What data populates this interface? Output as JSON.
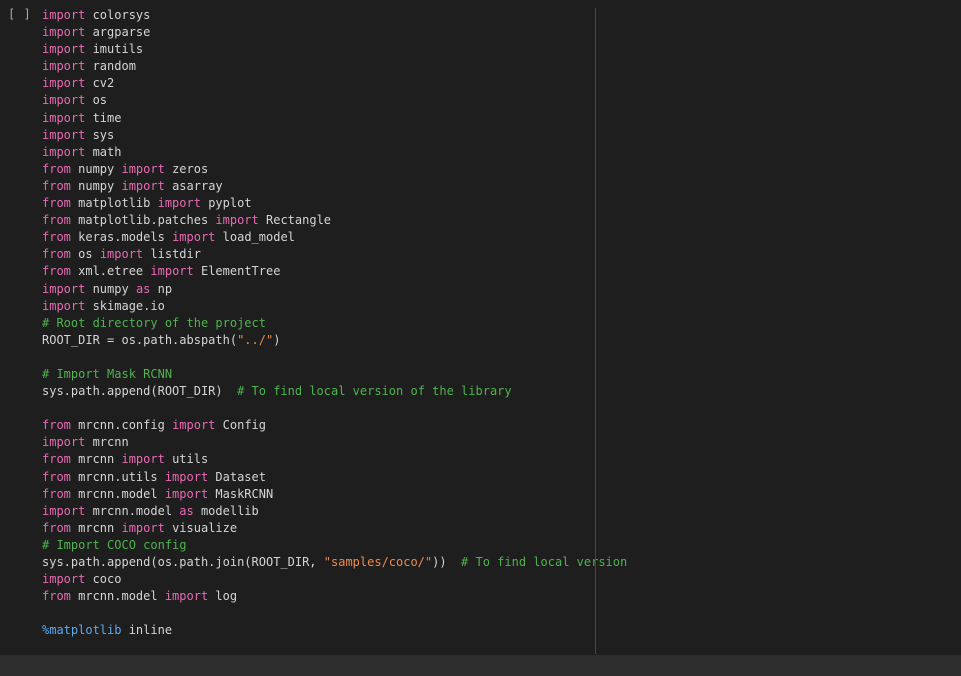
{
  "cell": {
    "run_indicator": "[ ]",
    "lines": [
      [
        {
          "t": "import",
          "c": "kw"
        },
        {
          "t": " colorsys",
          "c": "tx"
        }
      ],
      [
        {
          "t": "import",
          "c": "kw"
        },
        {
          "t": " argparse",
          "c": "tx"
        }
      ],
      [
        {
          "t": "import",
          "c": "kw"
        },
        {
          "t": " imutils",
          "c": "tx"
        }
      ],
      [
        {
          "t": "import",
          "c": "kw"
        },
        {
          "t": " random",
          "c": "tx"
        }
      ],
      [
        {
          "t": "import",
          "c": "kw"
        },
        {
          "t": " cv2",
          "c": "tx"
        }
      ],
      [
        {
          "t": "import",
          "c": "kw"
        },
        {
          "t": " os",
          "c": "tx"
        }
      ],
      [
        {
          "t": "import",
          "c": "kw"
        },
        {
          "t": " time",
          "c": "tx"
        }
      ],
      [
        {
          "t": "import",
          "c": "kw"
        },
        {
          "t": " sys",
          "c": "tx"
        }
      ],
      [
        {
          "t": "import",
          "c": "kw"
        },
        {
          "t": " math",
          "c": "tx"
        }
      ],
      [
        {
          "t": "from",
          "c": "kw"
        },
        {
          "t": " numpy ",
          "c": "tx"
        },
        {
          "t": "import",
          "c": "kw"
        },
        {
          "t": " zeros",
          "c": "tx"
        }
      ],
      [
        {
          "t": "from",
          "c": "kw"
        },
        {
          "t": " numpy ",
          "c": "tx"
        },
        {
          "t": "import",
          "c": "kw"
        },
        {
          "t": " asarray",
          "c": "tx"
        }
      ],
      [
        {
          "t": "from",
          "c": "kw"
        },
        {
          "t": " matplotlib ",
          "c": "tx"
        },
        {
          "t": "import",
          "c": "kw"
        },
        {
          "t": " pyplot",
          "c": "tx"
        }
      ],
      [
        {
          "t": "from",
          "c": "kw"
        },
        {
          "t": " matplotlib.patches ",
          "c": "tx"
        },
        {
          "t": "import",
          "c": "kw"
        },
        {
          "t": " Rectangle",
          "c": "tx"
        }
      ],
      [
        {
          "t": "from",
          "c": "kw"
        },
        {
          "t": " keras.models ",
          "c": "tx"
        },
        {
          "t": "import",
          "c": "kw"
        },
        {
          "t": " load_model",
          "c": "tx"
        }
      ],
      [
        {
          "t": "from",
          "c": "kw"
        },
        {
          "t": " os ",
          "c": "tx"
        },
        {
          "t": "import",
          "c": "kw"
        },
        {
          "t": " listdir",
          "c": "tx"
        }
      ],
      [
        {
          "t": "from",
          "c": "kw"
        },
        {
          "t": " xml.etree ",
          "c": "tx"
        },
        {
          "t": "import",
          "c": "kw"
        },
        {
          "t": " ElementTree",
          "c": "tx"
        }
      ],
      [
        {
          "t": "import",
          "c": "kw"
        },
        {
          "t": " numpy ",
          "c": "tx"
        },
        {
          "t": "as",
          "c": "kw"
        },
        {
          "t": " np",
          "c": "tx"
        }
      ],
      [
        {
          "t": "import",
          "c": "kw"
        },
        {
          "t": " skimage.io",
          "c": "tx"
        }
      ],
      [
        {
          "t": "# Root directory of the project",
          "c": "cm"
        }
      ],
      [
        {
          "t": "ROOT_DIR = os.path.abspath(",
          "c": "tx"
        },
        {
          "t": "\"../\"",
          "c": "st"
        },
        {
          "t": ")",
          "c": "tx"
        }
      ],
      [],
      [
        {
          "t": "# Import Mask RCNN",
          "c": "cm"
        }
      ],
      [
        {
          "t": "sys.path.append(ROOT_DIR)  ",
          "c": "tx"
        },
        {
          "t": "# To find local version of the library",
          "c": "cm"
        }
      ],
      [],
      [
        {
          "t": "from",
          "c": "kw"
        },
        {
          "t": " mrcnn.config ",
          "c": "tx"
        },
        {
          "t": "import",
          "c": "kw"
        },
        {
          "t": " Config",
          "c": "tx"
        }
      ],
      [
        {
          "t": "import",
          "c": "kw"
        },
        {
          "t": " mrcnn",
          "c": "tx"
        }
      ],
      [
        {
          "t": "from",
          "c": "kw"
        },
        {
          "t": " mrcnn ",
          "c": "tx"
        },
        {
          "t": "import",
          "c": "kw"
        },
        {
          "t": " utils",
          "c": "tx"
        }
      ],
      [
        {
          "t": "from",
          "c": "kw"
        },
        {
          "t": " mrcnn.utils ",
          "c": "tx"
        },
        {
          "t": "import",
          "c": "kw"
        },
        {
          "t": " Dataset",
          "c": "tx"
        }
      ],
      [
        {
          "t": "from",
          "c": "kw"
        },
        {
          "t": " mrcnn.model ",
          "c": "tx"
        },
        {
          "t": "import",
          "c": "kw"
        },
        {
          "t": " MaskRCNN",
          "c": "tx"
        }
      ],
      [
        {
          "t": "import",
          "c": "kw"
        },
        {
          "t": " mrcnn.model ",
          "c": "tx"
        },
        {
          "t": "as",
          "c": "kw"
        },
        {
          "t": " modellib",
          "c": "tx"
        }
      ],
      [
        {
          "t": "from",
          "c": "kw"
        },
        {
          "t": " mrcnn ",
          "c": "tx"
        },
        {
          "t": "import",
          "c": "kw"
        },
        {
          "t": " visualize",
          "c": "tx"
        }
      ],
      [
        {
          "t": "# Import COCO config",
          "c": "cm"
        }
      ],
      [
        {
          "t": "sys.path.append(os.path.join(ROOT_DIR, ",
          "c": "tx"
        },
        {
          "t": "\"samples/coco/\"",
          "c": "st"
        },
        {
          "t": "))  ",
          "c": "tx"
        },
        {
          "t": "# To find local version",
          "c": "cm"
        }
      ],
      [
        {
          "t": "import",
          "c": "kw"
        },
        {
          "t": " coco",
          "c": "tx"
        }
      ],
      [
        {
          "t": "from",
          "c": "kw"
        },
        {
          "t": " mrcnn.model ",
          "c": "tx"
        },
        {
          "t": "import",
          "c": "kw"
        },
        {
          "t": " log",
          "c": "tx"
        }
      ],
      [],
      [
        {
          "t": "%matplotlib",
          "c": "mg"
        },
        {
          "t": " inline",
          "c": "tx"
        }
      ]
    ]
  },
  "colors": {
    "background": "#1e1e1e",
    "keyword": "#e86ab4",
    "comment": "#4fb34f",
    "string": "#ee8a4e",
    "magic": "#5aa9f2",
    "text": "#d4d4d4",
    "status_bar": "#2d2d2d"
  }
}
